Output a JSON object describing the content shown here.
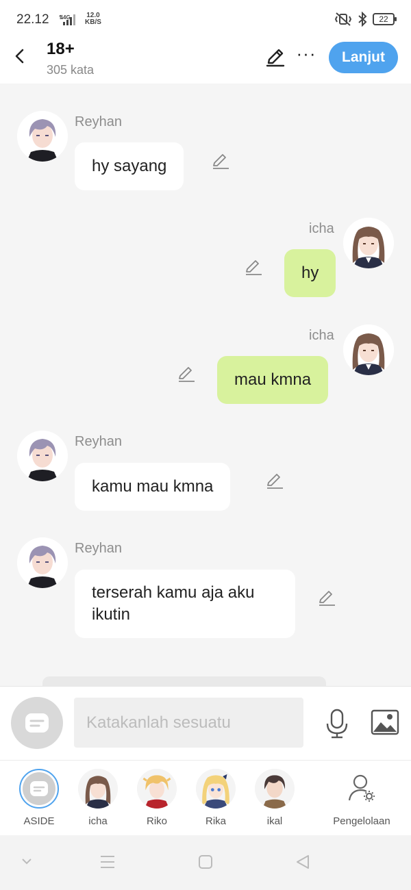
{
  "status_bar": {
    "time": "22.12",
    "network": "4G",
    "speed_top": "12.0",
    "speed_bottom": "KB/S",
    "battery": "22"
  },
  "header": {
    "title": "18+",
    "subtitle": "305 kata",
    "next_label": "Lanjut"
  },
  "messages": [
    {
      "sender": "Reyhan",
      "side": "left",
      "text": "hy sayang"
    },
    {
      "sender": "icha",
      "side": "right",
      "text": "hy"
    },
    {
      "sender": "icha",
      "side": "right",
      "text": "mau kmna"
    },
    {
      "sender": "Reyhan",
      "side": "left",
      "text": "kamu mau kmna"
    },
    {
      "sender": "Reyhan",
      "side": "left",
      "text": "terserah kamu aja aku ikutin"
    }
  ],
  "input": {
    "placeholder": "Katakanlah sesuatu"
  },
  "characters": [
    {
      "label": "ASIDE"
    },
    {
      "label": "icha"
    },
    {
      "label": "Riko"
    },
    {
      "label": "Rika"
    },
    {
      "label": "ikal"
    }
  ],
  "manage_label": "Pengelolaan",
  "colors": {
    "accent": "#4fa3ee",
    "right_bubble": "#d8f29d",
    "left_bubble": "#ffffff",
    "background": "#f5f5f5"
  }
}
